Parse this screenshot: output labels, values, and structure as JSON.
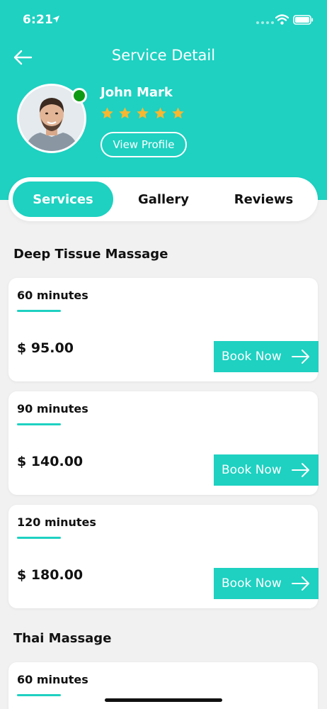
{
  "status_bar": {
    "time": "6:21"
  },
  "header": {
    "title": "Service Detail"
  },
  "profile": {
    "name": "John Mark",
    "rating": 5,
    "rating_max": 5,
    "view_profile_label": "View Profile",
    "online": true
  },
  "tabs": [
    {
      "label": "Services",
      "active": true
    },
    {
      "label": "Gallery",
      "active": false
    },
    {
      "label": "Reviews",
      "active": false
    }
  ],
  "sections": [
    {
      "title": "Deep Tissue Massage",
      "options": [
        {
          "duration": "60 minutes",
          "price": "$ 95.00",
          "button": "Book Now"
        },
        {
          "duration": "90 minutes",
          "price": "$ 140.00",
          "button": "Book Now"
        },
        {
          "duration": "120 minutes",
          "price": "$ 180.00",
          "button": "Book Now"
        }
      ]
    },
    {
      "title": "Thai Massage",
      "options": [
        {
          "duration": "60 minutes"
        }
      ]
    }
  ],
  "colors": {
    "accent": "#1ed1c1",
    "online": "#0f9a14",
    "star": "#f7b731"
  },
  "icons": {
    "back": "arrow-left-icon",
    "book": "arrow-right-icon",
    "star": "star-icon",
    "location": "location-arrow-icon",
    "wifi": "wifi-icon",
    "battery": "battery-icon"
  }
}
